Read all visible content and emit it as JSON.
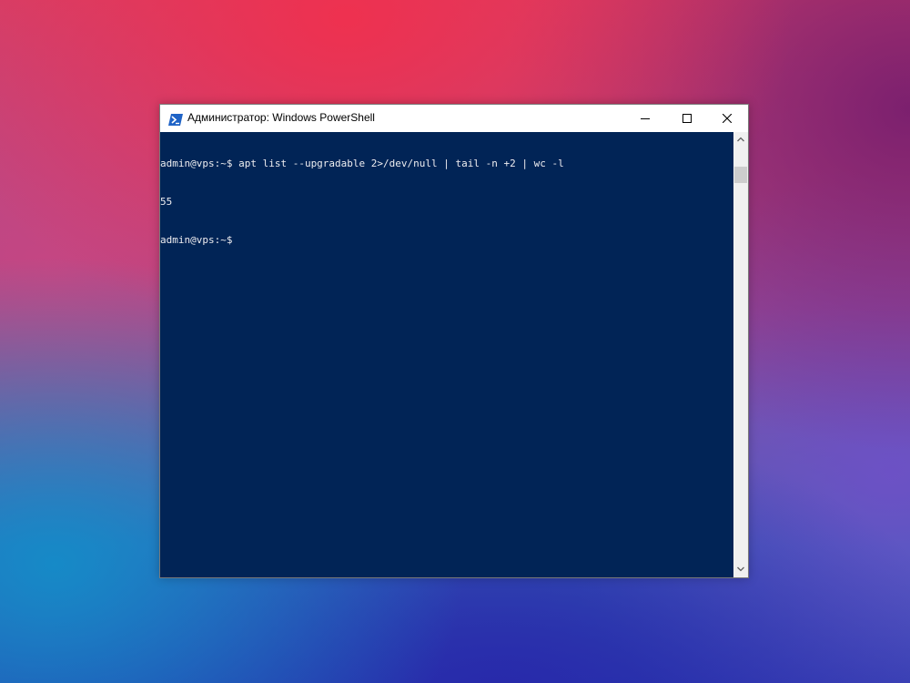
{
  "window": {
    "title": "Администратор: Windows PowerShell",
    "icon": "powershell-icon"
  },
  "controls": {
    "minimize_icon": "minimize-icon",
    "maximize_icon": "maximize-icon",
    "close_icon": "close-icon"
  },
  "console": {
    "lines": [
      "admin@vps:~$ apt list --upgradable 2>/dev/null | tail -n +2 | wc -l",
      "55",
      "admin@vps:~$"
    ]
  },
  "scrollbar": {
    "up_icon": "chevron-up-icon",
    "down_icon": "chevron-down-icon"
  },
  "colors": {
    "console_background": "#012456",
    "console_text": "#eeedf0",
    "titlebar_background": "#ffffff"
  }
}
